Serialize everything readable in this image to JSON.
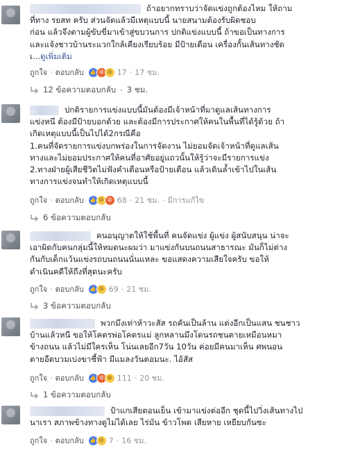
{
  "colors": {
    "link": "#365899",
    "meta_grey": "#90949c",
    "text": "#1d2129",
    "like_blue": "#4c7be8"
  },
  "comments": [
    {
      "text": "ถ้าอยากทราบว่าจัดแข่งถูกต้องไหม ให้ถาม\nที่ทาง รยสท ครับ ส่วนจัดแล้วมีเหตุแบบนี้ นายสนามต้องรับผิดชอบ\nก่อน แล้วจึงตามผู้ขับขี่มาเข้าสู่ขบวนการ ปกติแข่งแบบนี้ ถ้าขอเป็นทางการ\nและแจ้งชาวบ้านระแวกใกล้เคียงเรียบร้อย มีป้ายเตือน เครื่องกั้นเส้นทางชัด\nเ...",
      "more": "ดูเพิ่มเติม",
      "like": "ถูกใจ",
      "reply": "ตอบกลับ",
      "reaction_icons": [
        "like-icon",
        "angry-icon",
        "sad-icon"
      ],
      "reaction_count": "17",
      "time": "17 ชม.",
      "edited": "",
      "replies_label": "12 ข้อความตอบกลับ",
      "replies_time": "3 ชม."
    },
    {
      "text": "ปกติรายการแข่งแบบนี้มันต้องมีเจ้าหน้าที่มาดูแลเส้นทางการ\nแข่งหนึ ต้องมีป้ายบอกด้วย และต้องมีการประกาศให้คนในพื้นที่ได้รู้ด้วย ถ้า\nเกิดเหตุแบบนี้เป็นไปได้2กรณีคือ\n1.คนที่จัดรายการแข่งบกพร่องในการจัดงาน ไม่ยอมจัดเจ้าหน้าที่ดูแลเส้น\nทางและไม่ยอมประกาศให้คนที่อาศัยอยู่แถวนั้นให้รู้ว่าจะมีรายการแข่ง\n2.ทางฝ่ายผู้เสียชีวิตไม่ฟังคำเตือนหรือป้ายเตือน แล้วเดินล้ำเข้าไปในเส้น\nทางการแข่งจนทำให้เกิดเหตุแบบนี้",
      "more": "",
      "like": "ถูกใจ",
      "reply": "ตอบกลับ",
      "reaction_icons": [
        "like-icon",
        "sad-icon",
        "angry-icon"
      ],
      "reaction_count": "68",
      "time": "21 ชม.",
      "edited": "มีการแก้ไข",
      "replies_label": "6 ข้อความตอบกลับ",
      "replies_time": ""
    },
    {
      "text": "คนอนุญาตให้ใช้พื้นที่ คนจัดแข่ง ผู้แข่ง ผู้สนับสนุน น่าจะ\nเอาผิดกับคนกลุ่มนี้ให้หมดนะผมว่า มาแข่งกันบนถนนสาธารณะ มันก็ไม่ต่าง\nกันกับเด็กแว้นแข่งรถบนถนนนั่นแหละ ขอแสดงความเสียใจครับ ขอให้\nดำเนินคดีให้ถึงที่สุดนะครับ",
      "more": "",
      "like": "ถูกใจ",
      "reply": "ตอบกลับ",
      "reaction_icons": [
        "like-icon",
        "sad-icon"
      ],
      "reaction_count": "69",
      "time": "21 ชม.",
      "edited": "",
      "replies_label": "3 ข้อความตอบกลับ",
      "replies_time": ""
    },
    {
      "text": "พวกมึงเท่าห้าวะสัส รถคันเป็นล้าน แต่งอีกเป็นแสน ชนชาว\nบ้านแล้วหนี ขอให้โคตรพ่อโคตรแม่ ลูกหลานมึงโดนรถชนตายเหมือนหมา\nข้างถนน แล้วไม่มีใครเห็น โน่นเลยอีก7วัน 10วัน ค่อยมีคนมาเห็น ศพนอน\nตายอืดบวมเบ่งขาชี้ฟ้า มีแมลงวันตอมนะ. ไอ้สัส",
      "more": "",
      "like": "ถูกใจ",
      "reply": "ตอบกลับ",
      "reaction_icons": [
        "like-icon",
        "angry-icon",
        "haha-icon"
      ],
      "reaction_count": "111",
      "time": "20 ชม.",
      "edited": "",
      "replies_label": "1 ข้อความตอบกลับ",
      "replies_time": ""
    },
    {
      "text": "ป้าแกเสียตอนเย็น เข้ามาแข่งต่ออีก ชุดนี้ไปวิ่งเส้นทางไป\nนาเรา สภาพข้างทางดูไม่ได้เลย ไร่มัน ข้าวโพด เสียหาย เหยียบกันซะ",
      "more": "",
      "like": "ถูกใจ",
      "reply": "ตอบกลับ",
      "reaction_icons": [
        "like-icon",
        "sad-icon"
      ],
      "reaction_count": "7",
      "time": "16 ชม.",
      "edited": "",
      "replies_label": "",
      "replies_time": ""
    }
  ]
}
